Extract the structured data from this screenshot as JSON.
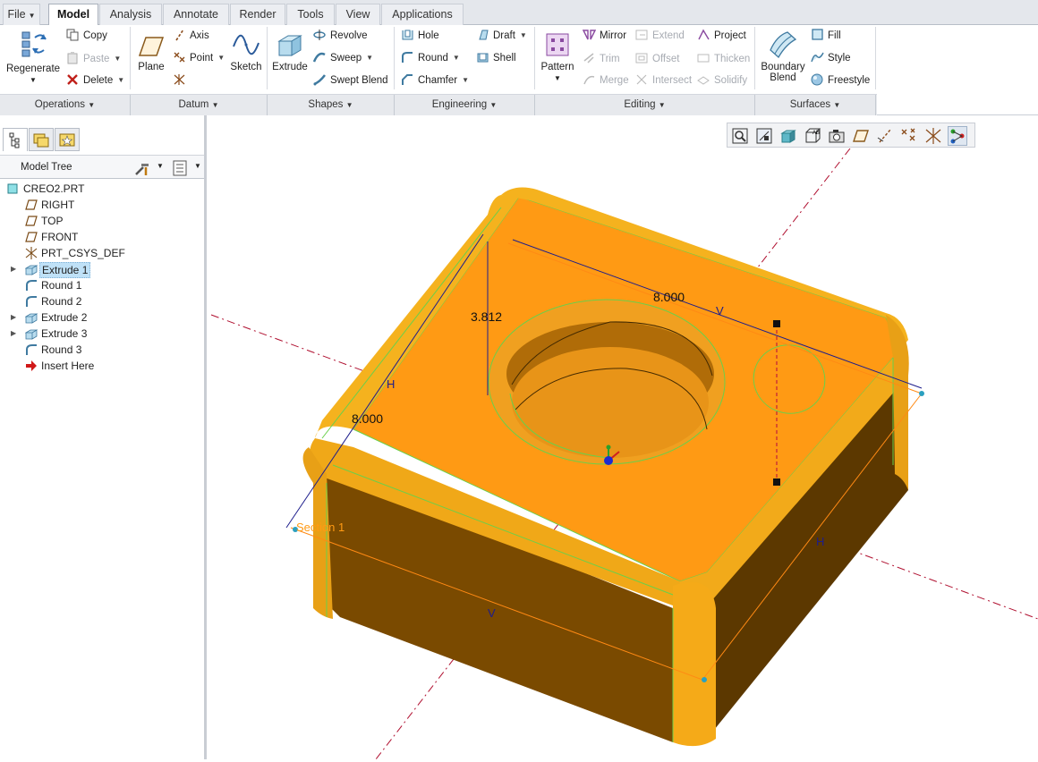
{
  "tabs": [
    {
      "label": "File",
      "dropdown": true
    },
    {
      "label": "Model",
      "active": true
    },
    {
      "label": "Analysis"
    },
    {
      "label": "Annotate"
    },
    {
      "label": "Render"
    },
    {
      "label": "Tools"
    },
    {
      "label": "View"
    },
    {
      "label": "Applications"
    }
  ],
  "ribbon": {
    "operations": {
      "regenerate": "Regenerate",
      "copy": "Copy",
      "paste": "Paste",
      "delete": "Delete"
    },
    "datum": {
      "plane": "Plane",
      "axis": "Axis",
      "point": "Point",
      "sketch": "Sketch"
    },
    "shapes": {
      "extrude": "Extrude",
      "revolve": "Revolve",
      "sweep": "Sweep",
      "swept_blend": "Swept Blend"
    },
    "engineering": {
      "hole": "Hole",
      "round": "Round",
      "chamfer": "Chamfer",
      "draft": "Draft",
      "shell": "Shell"
    },
    "editing": {
      "pattern": "Pattern",
      "mirror": "Mirror",
      "trim": "Trim",
      "merge": "Merge",
      "extend": "Extend",
      "offset": "Offset",
      "intersect": "Intersect",
      "project": "Project",
      "thicken": "Thicken",
      "solidify": "Solidify"
    },
    "surfaces": {
      "boundary_blend_1": "Boundary",
      "boundary_blend_2": "Blend",
      "fill": "Fill",
      "style": "Style",
      "freestyle": "Freestyle"
    }
  },
  "groups": [
    "Operations",
    "Datum",
    "Shapes",
    "Engineering",
    "Editing",
    "Surfaces"
  ],
  "model_tree": {
    "title": "Model Tree",
    "items": [
      {
        "label": "CREO2.PRT",
        "icon": "part-icon"
      },
      {
        "label": "RIGHT",
        "icon": "datum-plane-icon"
      },
      {
        "label": "TOP",
        "icon": "datum-plane-icon"
      },
      {
        "label": "FRONT",
        "icon": "datum-plane-icon"
      },
      {
        "label": "PRT_CSYS_DEF",
        "icon": "csys-icon"
      },
      {
        "label": "Extrude 1",
        "icon": "extrude-icon",
        "expandable": true,
        "selected": true
      },
      {
        "label": "Round 1",
        "icon": "round-icon"
      },
      {
        "label": "Round 2",
        "icon": "round-icon"
      },
      {
        "label": "Extrude 2",
        "icon": "extrude-icon",
        "expandable": true
      },
      {
        "label": "Extrude 3",
        "icon": "extrude-icon",
        "expandable": true
      },
      {
        "label": "Round 3",
        "icon": "round-icon"
      },
      {
        "label": "Insert Here",
        "icon": "insert-arrow-icon"
      }
    ]
  },
  "graphics": {
    "dim_top": "8.000",
    "dim_left": "8.000",
    "dim_height": "3.812",
    "section_label": "Section 1",
    "label_h": "H",
    "label_v": "V"
  },
  "colors": {
    "top_face": "#ff9a14",
    "side_left": "#7a4a00",
    "side_right": "#5a3500",
    "rounded_edge": "#f5b21e",
    "dimension": "#1d1d8c"
  }
}
